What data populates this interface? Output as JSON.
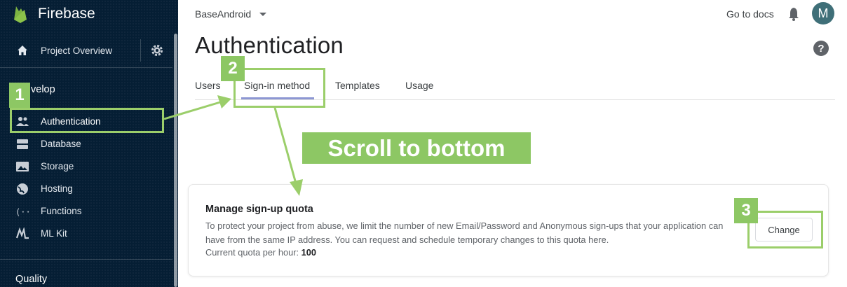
{
  "sidebar": {
    "brand": "Firebase",
    "overview_label": "Project Overview",
    "develop_title": "velop",
    "items": [
      {
        "label": "Authentication",
        "icon": "people-icon"
      },
      {
        "label": "Database",
        "icon": "database-icon"
      },
      {
        "label": "Storage",
        "icon": "storage-icon"
      },
      {
        "label": "Hosting",
        "icon": "globe-icon"
      },
      {
        "label": "Functions",
        "icon": "functions-icon"
      },
      {
        "label": "ML Kit",
        "icon": "mlkit-icon"
      }
    ],
    "quality_title": "Quality"
  },
  "header": {
    "project": "BaseAndroid",
    "docs_link": "Go to docs",
    "avatar_letter": "M"
  },
  "main": {
    "title": "Authentication",
    "tabs": [
      {
        "label": "Users"
      },
      {
        "label": "Sign-in method"
      },
      {
        "label": "Templates"
      },
      {
        "label": "Usage"
      }
    ],
    "card": {
      "title": "Manage sign-up quota",
      "desc": "To protect your project from abuse, we limit the number of new Email/Password and Anonymous sign-ups that your application can have from the same IP address. You can request and schedule temporary changes to this quota here.",
      "quota_label": "Current quota per hour:",
      "quota_value": "100",
      "change_button": "Change"
    }
  },
  "annotations": {
    "step1": "1",
    "step2": "2",
    "step3": "3",
    "banner": "Scroll to bottom",
    "color": "#8dc764"
  }
}
